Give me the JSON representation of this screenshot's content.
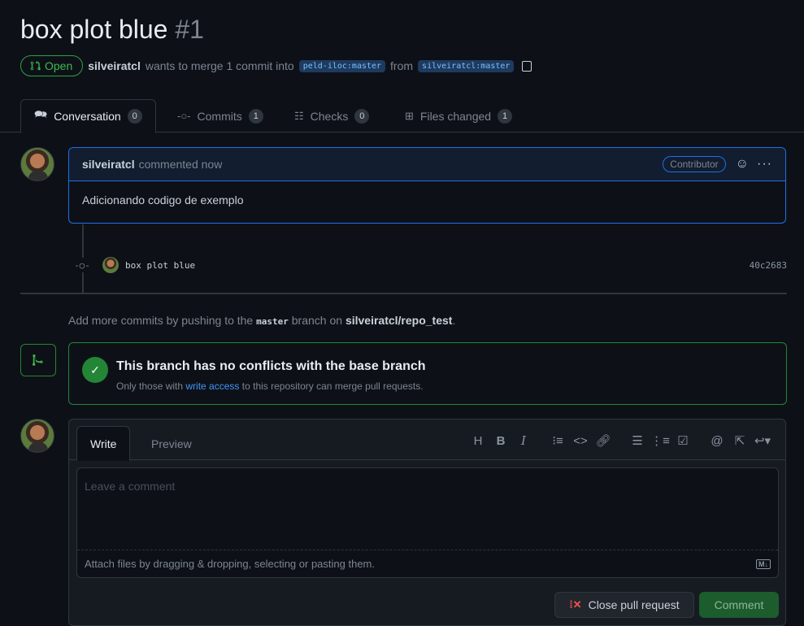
{
  "pr": {
    "title": "box plot blue",
    "number": "#1",
    "state": "Open",
    "author": "silveiratcl",
    "merge_text": "wants to merge 1 commit into",
    "base_branch": "peld-iloc:master",
    "from_text": "from",
    "head_branch": "silveiratcl:master"
  },
  "tabs": [
    {
      "label": "Conversation",
      "count": "0"
    },
    {
      "label": "Commits",
      "count": "1"
    },
    {
      "label": "Checks",
      "count": "0"
    },
    {
      "label": "Files changed",
      "count": "1"
    }
  ],
  "comment": {
    "author": "silveiratcl",
    "time": "commented now",
    "badge": "Contributor",
    "body": "Adicionando codigo de exemplo"
  },
  "commit": {
    "message": "box plot blue",
    "sha": "40c2683"
  },
  "info": {
    "prefix": "Add more commits by pushing to the",
    "branch": "master",
    "middle": "branch on",
    "repo": "silveiratcl/repo_test",
    "suffix": "."
  },
  "merge": {
    "title": "This branch has no conflicts with the base branch",
    "sub_prefix": "Only those with",
    "sub_link": "write access",
    "sub_suffix": "to this repository can merge pull requests."
  },
  "editor": {
    "write_tab": "Write",
    "preview_tab": "Preview",
    "placeholder": "Leave a comment",
    "attach_text": "Attach files by dragging & dropping, selecting or pasting them.",
    "md_badge": "M↓",
    "toolbar": {
      "heading": "H",
      "bold": "B",
      "italic": "I"
    }
  },
  "buttons": {
    "close_pr": "Close pull request",
    "comment": "Comment"
  }
}
